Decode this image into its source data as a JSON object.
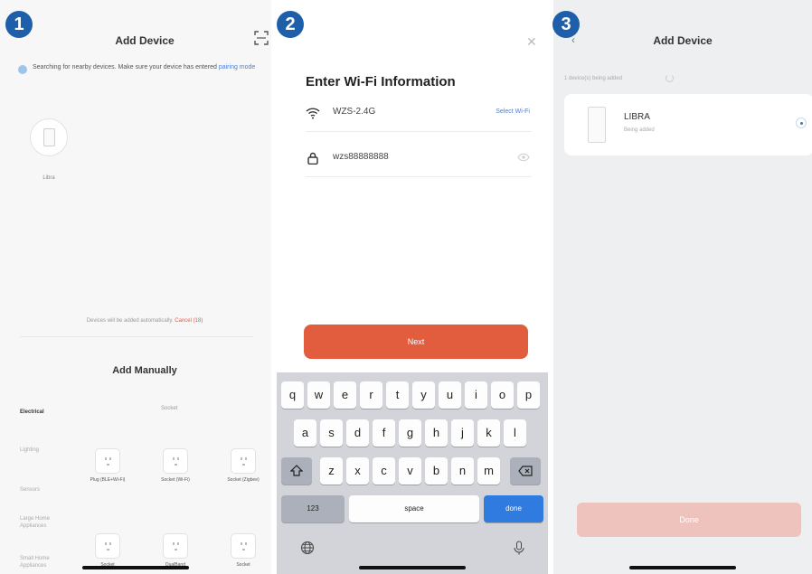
{
  "steps": [
    "1",
    "2",
    "3"
  ],
  "panel1": {
    "title": "Add Device",
    "notice_text": "Searching for nearby devices. Make sure your device has entered",
    "notice_link": "pairing mode",
    "found_device": "Libra",
    "auto_text": "Devices will be added automatically.",
    "cancel_link": "Cancel (18)",
    "manual_title": "Add Manually",
    "categories": [
      "Electrical",
      "Lighting",
      "Sensors",
      "Large Home Appliances",
      "Small Home Appliances"
    ],
    "subheading": "Socket",
    "items": [
      {
        "label": "Plug (BLE+Wi-Fi)"
      },
      {
        "label": "Socket (Wi-Fi)"
      },
      {
        "label": "Socket (Zigbee)"
      },
      {
        "label": "Socket"
      },
      {
        "label": "DualBand"
      },
      {
        "label": "Socket"
      }
    ]
  },
  "panel2": {
    "heading": "Enter Wi-Fi Information",
    "wifi_name": "WZS-2.4G",
    "select_wifi": "Select Wi-Fi",
    "password": "wzs88888888",
    "next_label": "Next",
    "keyboard": {
      "row1": [
        "q",
        "w",
        "e",
        "r",
        "t",
        "y",
        "u",
        "i",
        "o",
        "p"
      ],
      "row2": [
        "a",
        "s",
        "d",
        "f",
        "g",
        "h",
        "j",
        "k",
        "l"
      ],
      "row3": [
        "z",
        "x",
        "c",
        "v",
        "b",
        "n",
        "m"
      ],
      "numbers": "123",
      "space": "space",
      "done": "done"
    }
  },
  "panel3": {
    "title": "Add Device",
    "status": "1 device(s) being added",
    "device_name": "LIBRA",
    "device_status": "Being added",
    "done_label": "Done"
  },
  "colors": {
    "badge": "#1f5fa9",
    "accent_orange": "#e15d3e",
    "link_blue": "#4a82d8",
    "key_done": "#2f7bdf"
  }
}
